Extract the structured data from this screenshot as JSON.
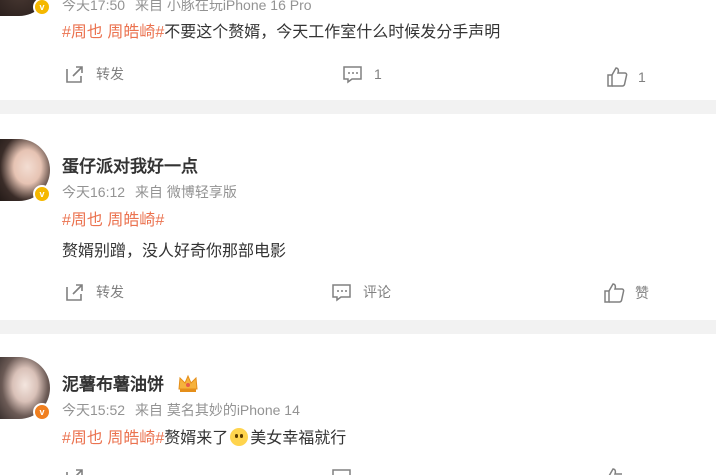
{
  "posts": [
    {
      "name": "",
      "time": "今天17:50",
      "source": "来自 小豚在玩iPhone 16 Pro",
      "hashtag": "#周也 周皓崎#",
      "text": "不要这个赘婿，今天工作室什么时候发分手声明",
      "repost_label": "转发",
      "comment_label": "1",
      "like_label": "1"
    },
    {
      "name": "蛋仔派对我好一点",
      "time": "今天16:12",
      "source": "来自 微博轻享版",
      "hashtag": "#周也 周皓崎#",
      "text": "赘婿别蹭，没人好奇你那部电影",
      "repost_label": "转发",
      "comment_label": "评论",
      "like_label": "赞"
    },
    {
      "name": "泥薯布薯油饼",
      "time": "今天15:52",
      "source": "来自 莫名其妙的iPhone 14",
      "hashtag": "#周也 周皓崎#",
      "text_before_emoji": "赘婿来了",
      "text_after_emoji": "美女幸福就行"
    }
  ],
  "colors": {
    "hashtag": "#eb7350",
    "meta": "#939393",
    "action": "#808080",
    "divider": "#f2f2f2",
    "badge_yellow": "#f5b800",
    "badge_orange": "#f07f1f"
  },
  "icons": {
    "repost": "share-arrow-icon",
    "comment": "comment-bubble-icon",
    "like": "thumbs-up-icon",
    "verified": "verified-v-badge-icon",
    "crown": "crown-icon",
    "emoji": "crying-face-emoji-icon"
  }
}
